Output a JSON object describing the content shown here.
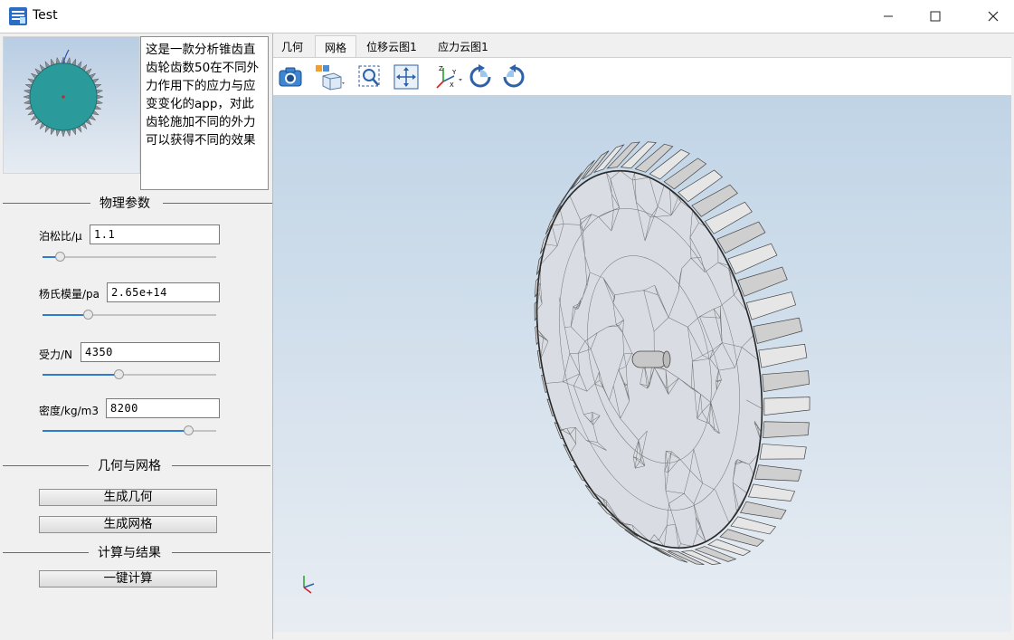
{
  "window": {
    "title": "Test"
  },
  "description": "这是一款分析锥齿直齿轮齿数50在不同外力作用下的应力与应变变化的app，对此齿轮施加不同的外力可以获得不同的效果",
  "sections": {
    "physics": "物理参数",
    "geometry_mesh": "几何与网格",
    "compute_result": "计算与结果"
  },
  "params": [
    {
      "label": "泊松比/μ",
      "value": "1.1",
      "slider_fraction": 0.1
    },
    {
      "label": "杨氏模量/pa",
      "value": "2.65e+14",
      "slider_fraction": 0.26
    },
    {
      "label": "受力/N",
      "value": "4350",
      "slider_fraction": 0.44
    },
    {
      "label": "密度/kg/m3",
      "value": "8200",
      "slider_fraction": 0.84
    }
  ],
  "buttons": {
    "gen_geometry": "生成几何",
    "gen_mesh": "生成网格",
    "one_click_compute": "一键计算"
  },
  "tabs": [
    "几何",
    "网格",
    "位移云图1",
    "应力云图1"
  ],
  "active_tab": "网格",
  "toolbar_icons": [
    "camera-icon",
    "view-orientation-icon",
    "zoom-box-icon",
    "zoom-fit-icon",
    "axis-triad-icon",
    "rotate-cw-icon",
    "rotate-ccw-icon"
  ],
  "colors": {
    "accent": "#2f7bcf",
    "viewport_top": "#c0d4e6",
    "viewport_bottom": "#e8edf3",
    "gear_thumb": "#2a9a9a"
  }
}
